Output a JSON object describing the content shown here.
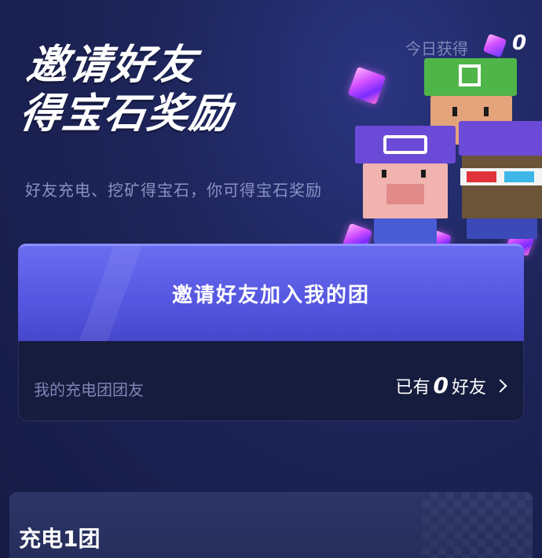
{
  "hero": {
    "title_line1": "邀请好友",
    "title_line2": "得宝石奖励",
    "subtitle": "好友充电、挖矿得宝石，你可得宝石奖励"
  },
  "invite": {
    "button_label": "邀请好友加入我的团",
    "members_label": "我的充电团团友",
    "members_prefix": "已有",
    "members_count": "0",
    "members_suffix": "好友"
  },
  "team": {
    "name": "充电1团",
    "today_label": "今日获得",
    "today_value": "0"
  },
  "colors": {
    "background": "#1b2150",
    "button": "#5556e0",
    "panel": "#161c3e",
    "gem": "#d04dff"
  },
  "icons": {
    "gem": "gem-icon",
    "chevron": "chevron-right-icon"
  }
}
